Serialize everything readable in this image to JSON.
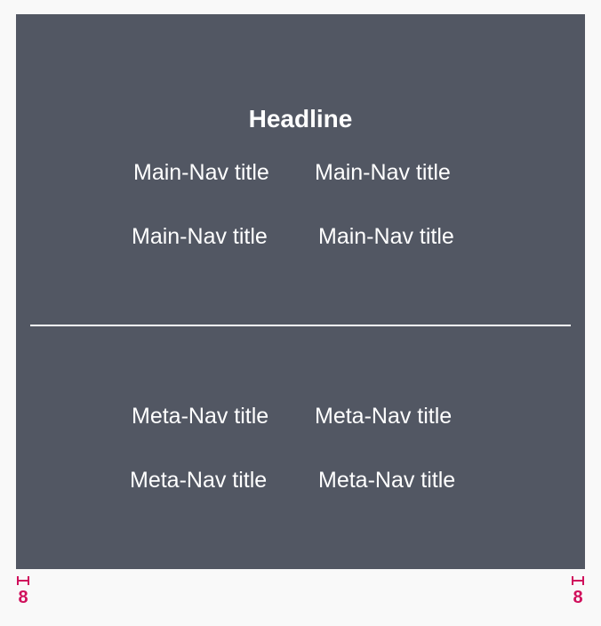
{
  "headline": "Headline",
  "main_nav": {
    "items": [
      {
        "label": "Main-Nav title"
      },
      {
        "label": "Main-Nav title"
      },
      {
        "label": "Main-Nav title"
      },
      {
        "label": "Main-Nav title"
      }
    ]
  },
  "meta_nav": {
    "items": [
      {
        "label": "Meta-Nav title"
      },
      {
        "label": "Meta-Nav title"
      },
      {
        "label": "Meta-Nav title"
      },
      {
        "label": "Meta-Nav title"
      }
    ]
  },
  "spacing": {
    "left_value": "8",
    "right_value": "8",
    "marker_color": "#d0105c"
  },
  "colors": {
    "panel_background": "#525763",
    "page_background": "#f9f9f9",
    "text": "#ffffff"
  }
}
